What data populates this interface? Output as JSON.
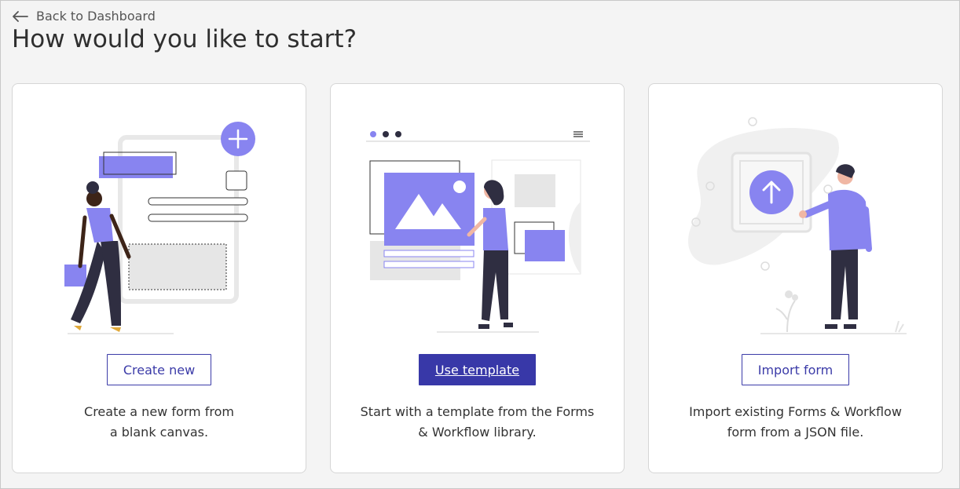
{
  "nav": {
    "back_label": "Back to Dashboard"
  },
  "page": {
    "title": "How would you like to start?"
  },
  "colors": {
    "accent": "#3838a8",
    "illustration": "#8884f0",
    "skin_dark": "#3d2418"
  },
  "cards": [
    {
      "button_label": "Create new",
      "desc_line1": "Create a new form from",
      "desc_line2": "a blank canvas."
    },
    {
      "button_label": "Use template",
      "desc_line1": "Start with a template from the Forms",
      "desc_line2": "& Workflow library."
    },
    {
      "button_label": "Import form",
      "desc_line1": "Import existing Forms & Workflow",
      "desc_line2": "form from a JSON file."
    }
  ]
}
